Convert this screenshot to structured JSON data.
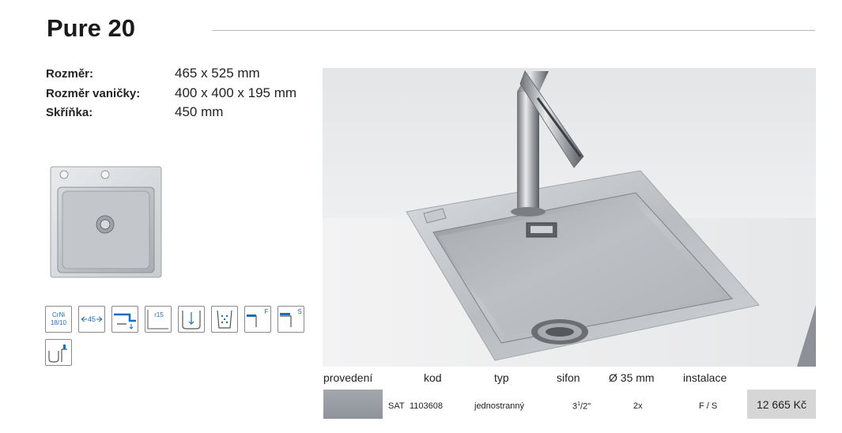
{
  "title": "Pure 20",
  "specs": [
    {
      "label": "Rozměr:",
      "value": "465 x 525 mm"
    },
    {
      "label": "Rozměr vaničky:",
      "value": "400 x 400 x 195 mm"
    },
    {
      "label": "Skříňka:",
      "value": "450 mm"
    }
  ],
  "icons": [
    {
      "name": "material-crni-icon",
      "text": "CrNi 18/10"
    },
    {
      "name": "cabinet-45-icon",
      "text": "45"
    },
    {
      "name": "overflow-icon",
      "text": ""
    },
    {
      "name": "radius-r15-icon",
      "text": "r15"
    },
    {
      "name": "bowl-depth-icon",
      "text": ""
    },
    {
      "name": "strainer-icon",
      "text": ""
    },
    {
      "name": "flush-mount-icon",
      "text": "F"
    },
    {
      "name": "surface-mount-icon",
      "text": "S"
    },
    {
      "name": "tap-hole-icon",
      "text": ""
    }
  ],
  "table": {
    "headers": [
      "provedení",
      "kod",
      "typ",
      "sifon",
      "Ø 35 mm",
      "instalace"
    ],
    "row": {
      "finish": "SAT",
      "code": "1103608",
      "type": "jednostranný",
      "siphon_main": "3",
      "siphon_sup": "1",
      "siphon_tail": "/2\"",
      "holes": "2x",
      "installation": "F / S",
      "price": "12 665 Kč"
    }
  },
  "colors": {
    "swatch": "#9a9ea3",
    "price_bg": "#d6d6d6",
    "rule": "#b8b8b8"
  }
}
